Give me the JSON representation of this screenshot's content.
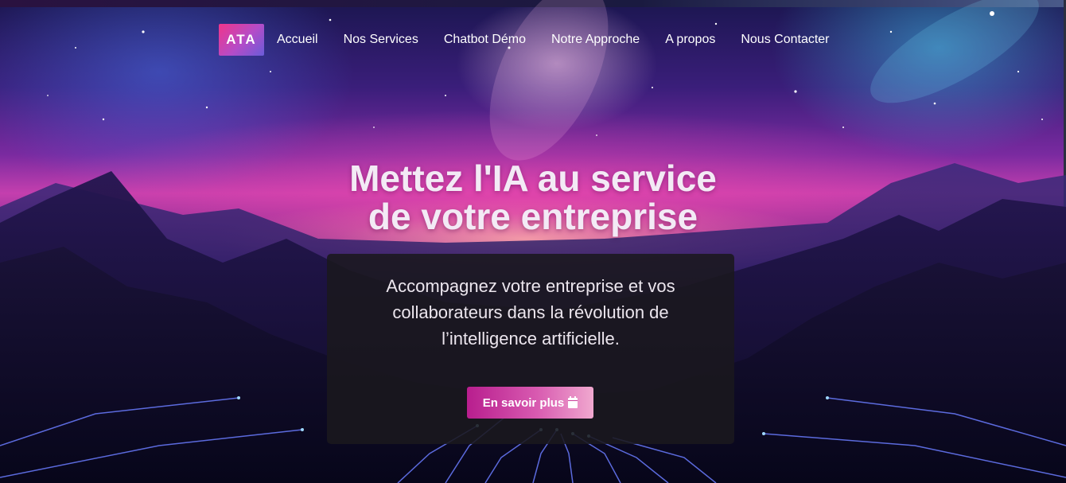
{
  "colors": {
    "accent_pink": "#f0358a",
    "accent_violet": "#6a5cd8",
    "button_start": "#b81e8e",
    "button_end": "#f0a8cf",
    "card_bg": "#1a181e",
    "text": "#ffffff"
  },
  "header": {
    "logo": "ATA",
    "nav": [
      {
        "label": "Accueil"
      },
      {
        "label": "Nos Services"
      },
      {
        "label": "Chatbot Démo"
      },
      {
        "label": "Notre Approche"
      },
      {
        "label": "A propos"
      },
      {
        "label": "Nous Contacter"
      }
    ]
  },
  "hero": {
    "title_line1": "Mettez l'IA au service",
    "title_line2": "de votre entreprise",
    "subtitle_lines": [
      "Accompagnez votre entreprise et vos",
      "collaborateurs dans la révolution de",
      "l’intelligence artificielle."
    ],
    "cta_label": "En savoir plus",
    "cta_icon": "calendar-icon"
  }
}
